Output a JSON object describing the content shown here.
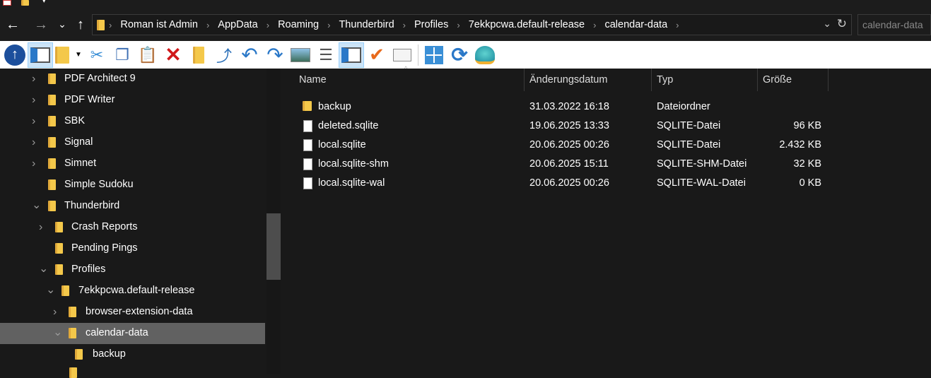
{
  "nav": {
    "back": "←",
    "forward": "→",
    "recent": "⌄",
    "up": "↑",
    "refresh": "↻",
    "dropdown": "⌄"
  },
  "breadcrumb": [
    "Roman ist  Admin",
    "AppData",
    "Roaming",
    "Thunderbird",
    "Profiles",
    "7ekkpcwa.default-release",
    "calendar-data"
  ],
  "search": {
    "placeholder": "calendar-data"
  },
  "tree": [
    {
      "label": "PDF Architect 9",
      "level": 0,
      "chevron": "›"
    },
    {
      "label": "PDF Writer",
      "level": 0,
      "chevron": "›"
    },
    {
      "label": "SBK",
      "level": 0,
      "chevron": "›"
    },
    {
      "label": "Signal",
      "level": 0,
      "chevron": "›"
    },
    {
      "label": "Simnet",
      "level": 0,
      "chevron": "›"
    },
    {
      "label": "Simple Sudoku",
      "level": 0,
      "chevron": ""
    },
    {
      "label": "Thunderbird",
      "level": 0,
      "chevron": "⌄"
    },
    {
      "label": "Crash Reports",
      "level": 1,
      "chevron": "›"
    },
    {
      "label": "Pending Pings",
      "level": 1,
      "chevron": ""
    },
    {
      "label": "Profiles",
      "level": 1,
      "chevron": "⌄"
    },
    {
      "label": "7ekkpcwa.default-release",
      "level": 2,
      "chevron": "⌄"
    },
    {
      "label": "browser-extension-data",
      "level": 3,
      "chevron": "›"
    },
    {
      "label": "calendar-data",
      "level": 3,
      "chevron": "⌄",
      "selected": true
    },
    {
      "label": "backup",
      "level": 4,
      "chevron": ""
    }
  ],
  "columns": {
    "name": "Name",
    "date": "Änderungsdatum",
    "type": "Typ",
    "size": "Größe"
  },
  "files": [
    {
      "name": "backup",
      "date": "31.03.2022 16:18",
      "type": "Dateiordner",
      "size": "",
      "folder": true
    },
    {
      "name": "deleted.sqlite",
      "date": "19.06.2025 13:33",
      "type": "SQLITE-Datei",
      "size": "96 KB"
    },
    {
      "name": "local.sqlite",
      "date": "20.06.2025 00:26",
      "type": "SQLITE-Datei",
      "size": "2.432 KB"
    },
    {
      "name": "local.sqlite-shm",
      "date": "20.06.2025 15:11",
      "type": "SQLITE-SHM-Datei",
      "size": "32 KB"
    },
    {
      "name": "local.sqlite-wal",
      "date": "20.06.2025 00:26",
      "type": "SQLITE-WAL-Datei",
      "size": "0 KB"
    }
  ]
}
